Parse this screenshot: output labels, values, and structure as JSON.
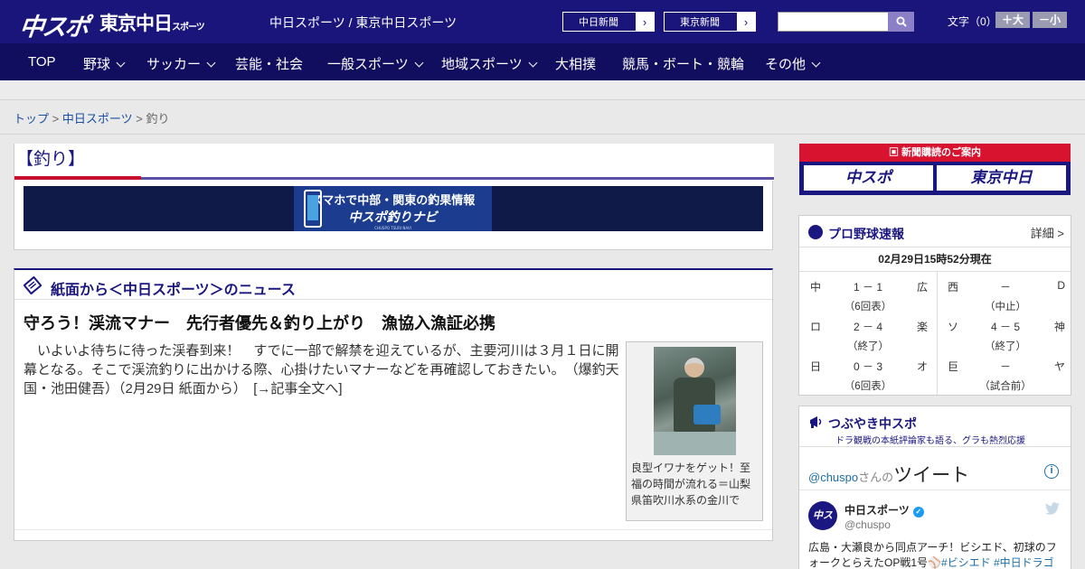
{
  "header": {
    "logo_main": "中スポ",
    "logo_tokyo": "東京中日",
    "logo_tokyo_small": "スポーツ",
    "site_links": "中日スポーツ / 東京中日スポーツ",
    "paper_buttons": [
      "中日新聞",
      "東京新聞"
    ],
    "search_placeholder": "",
    "fontsize_label": "文字（0）",
    "fontsize_up": "＋大",
    "fontsize_down": "－小"
  },
  "nav": {
    "items": [
      {
        "label": "TOP",
        "dropdown": false
      },
      {
        "label": "野球",
        "dropdown": true
      },
      {
        "label": "サッカー",
        "dropdown": true
      },
      {
        "label": "芸能・社会",
        "dropdown": false
      },
      {
        "label": "一般スポーツ",
        "dropdown": true
      },
      {
        "label": "地域スポーツ",
        "dropdown": true
      },
      {
        "label": "大相撲",
        "dropdown": false
      },
      {
        "label": "競馬・ボート・競輪",
        "dropdown": false
      },
      {
        "label": "その他",
        "dropdown": true
      }
    ]
  },
  "breadcrumb": {
    "items": [
      "トップ",
      "中日スポーツ"
    ],
    "current": "釣り",
    "separator": ">"
  },
  "section": {
    "title": "【釣り】",
    "banner_line1": "スマホで中部・関東の釣果情報",
    "banner_line2": "中スポ釣りナビ",
    "banner_line3": "CHUSPO TSURI NAVI"
  },
  "news": {
    "heading": "紙面から＜中日スポーツ＞のニュース",
    "article_title": "守ろう！渓流マナー　先行者優先＆釣り上がり　漁協入漁証必携",
    "article_body": "いよいよ待ちに待った渓春到来！　すでに一部で解禁を迎えているが、主要河川は３月１日に開幕となる。そこで渓流釣りに出かける際、心掛けたいマナーなどを再確認しておきたい。　（爆釣天国・池田健吾）（2月29日 紙面から）　[→記事全文へ]",
    "photo_caption": "良型イワナをゲット！至福の時間が流れる＝山梨県笛吹川水系の金川で"
  },
  "subscription": {
    "heading": "新聞購読のご案内",
    "logos": [
      "中スポ",
      "東京中日"
    ]
  },
  "baseball": {
    "title": "プロ野球速報",
    "more": "詳細 >",
    "timestamp": "02月29日15時52分現在",
    "games": [
      {
        "home": "中",
        "score": "1 － 1",
        "away": "広",
        "status": "（6回表）"
      },
      {
        "home": "西",
        "score": "－",
        "away": "D",
        "status": "（中止）"
      },
      {
        "home": "ロ",
        "score": "2 － 4",
        "away": "楽",
        "status": "（終了）"
      },
      {
        "home": "ソ",
        "score": "4 － 5",
        "away": "神",
        "status": "（終了）"
      },
      {
        "home": "日",
        "score": "0 － 3",
        "away": "オ",
        "status": "（6回表）"
      },
      {
        "home": "巨",
        "score": "－",
        "away": "ヤ",
        "status": "（試合前）"
      }
    ]
  },
  "twitter": {
    "title": "つぶやき中スポ",
    "subtitle": "ドラ観戦の本紙評論家も語る、グラも熱烈応援",
    "handle_link": "@chuspo",
    "handle_suffix": "さんの",
    "handle_big": "ツイート",
    "account_name": "中日スポーツ",
    "account_at": "@chuspo",
    "avatar_text": "中スポ",
    "tweet_text": "広島・大瀬良から同点アーチ！ビシエド、初球のフォークとらえたOP戦1号",
    "tweet_tags": "#ビシエド #中日ドラゴ"
  },
  "colors": {
    "header_bg": "#1a157a",
    "nav_bg": "#110d5f",
    "accent_red": "#c8102e",
    "accent_blue": "#1b1780"
  }
}
